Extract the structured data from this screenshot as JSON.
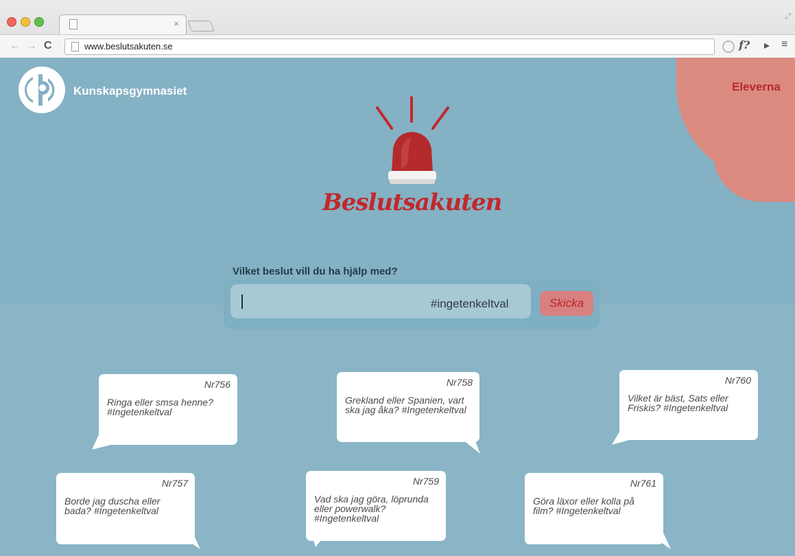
{
  "browser": {
    "url": "www.beslutsakuten.se",
    "tab_title": "",
    "tab_close": "×"
  },
  "site": {
    "brand": "Kunskapsgymnasiet",
    "nav_eleverna": "Eleverna",
    "wordmark": "Beslutsakuten",
    "colors": {
      "background": "#89b5c7",
      "accent": "#c1282c",
      "blob": "#db8a80"
    }
  },
  "form": {
    "question": "Vilket beslut vill du ha hjälp med?",
    "input_value": "",
    "hashtag_hint": "#ingetenkeltval",
    "send_label": "Skicka"
  },
  "bubbles": [
    {
      "nr": "Nr756",
      "text": "Ringa eller smsa henne? #Ingetenkeltval"
    },
    {
      "nr": "Nr758",
      "text": "Grekland eller Spanien, vart ska jag åka? #Ingetenkeltval"
    },
    {
      "nr": "Nr760",
      "text": "Vilket är bäst, Sats eller Friskis? #Ingetenkeltval"
    },
    {
      "nr": "Nr757",
      "text": "Borde jag duscha eller bada? #Ingetenkeltval"
    },
    {
      "nr": "Nr759",
      "text": "Vad ska jag göra, löprunda eller powerwalk? #Ingetenkeltval"
    },
    {
      "nr": "Nr761",
      "text": "Göra läxor eller kolla på film? #Ingetenkeltval"
    }
  ]
}
